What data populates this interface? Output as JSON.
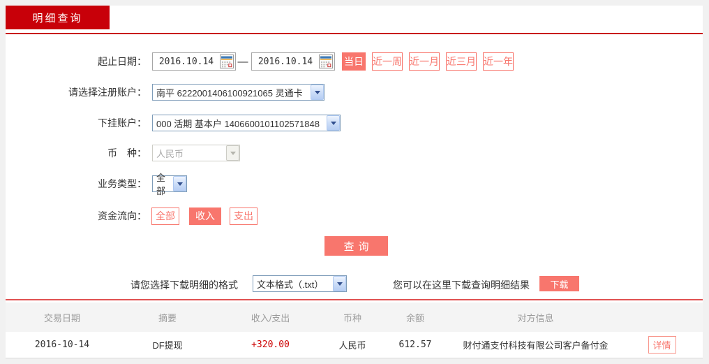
{
  "colors": {
    "brand_red": "#c80009",
    "accent_salmon": "#f8766d",
    "separator_red": "#e05252",
    "amount_red": "#cc0000",
    "header_text": "#9b9b9b"
  },
  "tab": {
    "label": "明细查询"
  },
  "form": {
    "date": {
      "label": "起止日期：",
      "from": "2016.10.14",
      "to": "2016.10.14",
      "separator": "—"
    },
    "quick_ranges": [
      {
        "label": "当日",
        "active": true
      },
      {
        "label": "近一周",
        "active": false
      },
      {
        "label": "近一月",
        "active": false
      },
      {
        "label": "近三月",
        "active": false
      },
      {
        "label": "近一年",
        "active": false
      }
    ],
    "account": {
      "label": "请选择注册账户：",
      "value": "南平 6222001406100921065 灵通卡"
    },
    "sub_account": {
      "label": "下挂账户：",
      "value": "000 活期 基本户 1406600101102571848"
    },
    "currency": {
      "label": "币　种：",
      "value": "人民币",
      "disabled": true
    },
    "biz_type": {
      "label": "业务类型：",
      "value": "全部"
    },
    "flow": {
      "label": "资金流向：",
      "options": [
        {
          "label": "全部",
          "active": false
        },
        {
          "label": "收入",
          "active": true
        },
        {
          "label": "支出",
          "active": false
        }
      ]
    },
    "query_button": "查询"
  },
  "download": {
    "format_label": "请您选择下载明细的格式",
    "format_value": "文本格式（.txt）",
    "hint": "您可以在这里下载查询明细结果",
    "button": "下载"
  },
  "table": {
    "headers": [
      "交易日期",
      "摘要",
      "收入/支出",
      "币种",
      "余额",
      "对方信息"
    ],
    "rows": [
      {
        "date": "2016-10-14",
        "summary": "DF提现",
        "amount": "+320.00",
        "currency": "人民币",
        "balance": "612.57",
        "counterparty": "财付通支付科技有限公司客户备付金",
        "action_label": "详情"
      }
    ]
  }
}
